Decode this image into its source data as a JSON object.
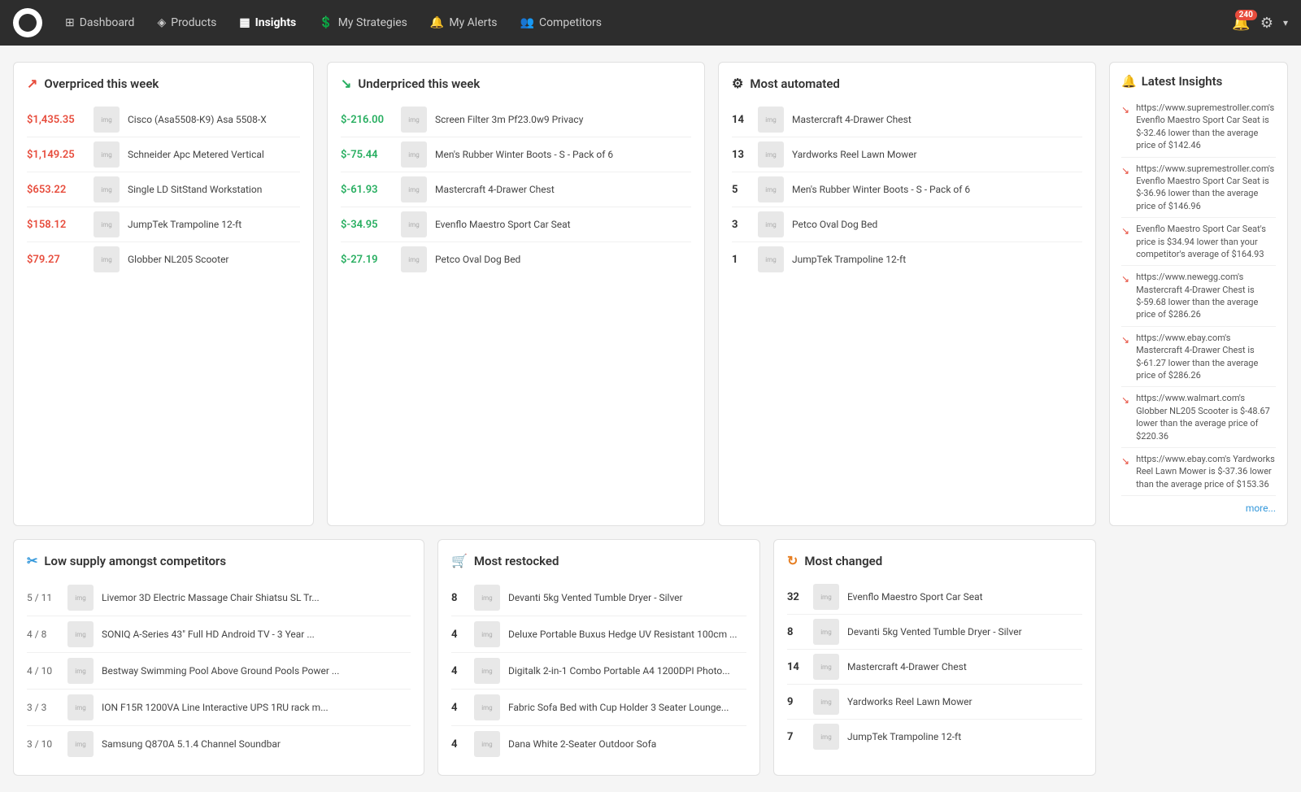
{
  "nav": {
    "items": [
      {
        "label": "Dashboard",
        "icon": "⊞",
        "active": false
      },
      {
        "label": "Products",
        "icon": "◈",
        "active": false
      },
      {
        "label": "Insights",
        "icon": "▦",
        "active": true
      },
      {
        "label": "My Strategies",
        "icon": "💲",
        "active": false
      },
      {
        "label": "My Alerts",
        "icon": "🔔",
        "active": false
      },
      {
        "label": "Competitors",
        "icon": "👥",
        "active": false
      }
    ],
    "bell_count": "240"
  },
  "overpriced": {
    "title": "Overpriced this week",
    "items": [
      {
        "price": "$1,435.35",
        "name": "Cisco (Asa5508-K9) Asa 5508-X"
      },
      {
        "price": "$1,149.25",
        "name": "Schneider Apc Metered Vertical"
      },
      {
        "price": "$653.22",
        "name": "Single LD SitStand Workstation"
      },
      {
        "price": "$158.12",
        "name": "JumpTek Trampoline 12-ft"
      },
      {
        "price": "$79.27",
        "name": "Globber NL205 Scooter"
      }
    ]
  },
  "underpriced": {
    "title": "Underpriced this week",
    "items": [
      {
        "price": "$-216.00",
        "name": "Screen Filter 3m Pf23.0w9 Privacy"
      },
      {
        "price": "$-75.44",
        "name": "Men's Rubber Winter Boots - S - Pack of 6"
      },
      {
        "price": "$-61.93",
        "name": "Mastercraft 4-Drawer Chest"
      },
      {
        "price": "$-34.95",
        "name": "Evenflo Maestro Sport Car Seat"
      },
      {
        "price": "$-27.19",
        "name": "Petco Oval Dog Bed"
      }
    ]
  },
  "most_automated": {
    "title": "Most automated",
    "items": [
      {
        "count": "14",
        "name": "Mastercraft 4-Drawer Chest"
      },
      {
        "count": "13",
        "name": "Yardworks Reel Lawn Mower"
      },
      {
        "count": "5",
        "name": "Men's Rubber Winter Boots - S - Pack of 6"
      },
      {
        "count": "3",
        "name": "Petco Oval Dog Bed"
      },
      {
        "count": "1",
        "name": "JumpTek Trampoline 12-ft"
      }
    ]
  },
  "latest_insights": {
    "title": "Latest Insights",
    "items": [
      {
        "text": "https://www.supremestroller.com's Evenflo Maestro Sport Car Seat is $-32.46 lower than the average price of $142.46"
      },
      {
        "text": "https://www.supremestroller.com's Evenflo Maestro Sport Car Seat is $-36.96 lower than the average price of $146.96"
      },
      {
        "text": "Evenflo Maestro Sport Car Seat's price is $34.94 lower than your competitor's average of $164.93"
      },
      {
        "text": "https://www.newegg.com's Mastercraft 4-Drawer Chest is $-59.68 lower than the average price of $286.26"
      },
      {
        "text": "https://www.ebay.com's Mastercraft 4-Drawer Chest is $-61.27 lower than the average price of $286.26"
      },
      {
        "text": "https://www.walmart.com's Globber NL205 Scooter is $-48.67 lower than the average price of $220.36"
      },
      {
        "text": "https://www.ebay.com's Yardworks Reel Lawn Mower is $-37.36 lower than the average price of $153.36"
      }
    ],
    "more": "more..."
  },
  "low_supply": {
    "title": "Low supply amongst competitors",
    "items": [
      {
        "ratio": "5 / 11",
        "name": "Livemor 3D Electric Massage Chair Shiatsu SL Tr..."
      },
      {
        "ratio": "4 / 8",
        "name": "SONIQ A-Series 43\" Full HD Android TV - 3 Year ..."
      },
      {
        "ratio": "4 / 10",
        "name": "Bestway Swimming Pool Above Ground Pools Power ..."
      },
      {
        "ratio": "3 / 3",
        "name": "ION F15R 1200VA Line Interactive UPS 1RU rack m..."
      },
      {
        "ratio": "3 / 10",
        "name": "Samsung Q870A 5.1.4 Channel Soundbar"
      }
    ]
  },
  "most_restocked": {
    "title": "Most restocked",
    "items": [
      {
        "count": "8",
        "name": "Devanti 5kg Vented Tumble Dryer - Silver"
      },
      {
        "count": "4",
        "name": "Deluxe Portable Buxus Hedge UV Resistant 100cm ..."
      },
      {
        "count": "4",
        "name": "Digitalk 2-in-1 Combo Portable A4 1200DPI Photo..."
      },
      {
        "count": "4",
        "name": "Fabric Sofa Bed with Cup Holder 3 Seater Lounge..."
      },
      {
        "count": "4",
        "name": "Dana White 2-Seater Outdoor Sofa"
      }
    ]
  },
  "most_changed": {
    "title": "Most changed",
    "items": [
      {
        "count": "32",
        "name": "Evenflo Maestro Sport Car Seat"
      },
      {
        "count": "8",
        "name": "Devanti 5kg Vented Tumble Dryer - Silver"
      },
      {
        "count": "14",
        "name": "Mastercraft 4-Drawer Chest"
      },
      {
        "count": "9",
        "name": "Yardworks Reel Lawn Mower"
      },
      {
        "count": "7",
        "name": "JumpTek Trampoline 12-ft"
      }
    ]
  }
}
